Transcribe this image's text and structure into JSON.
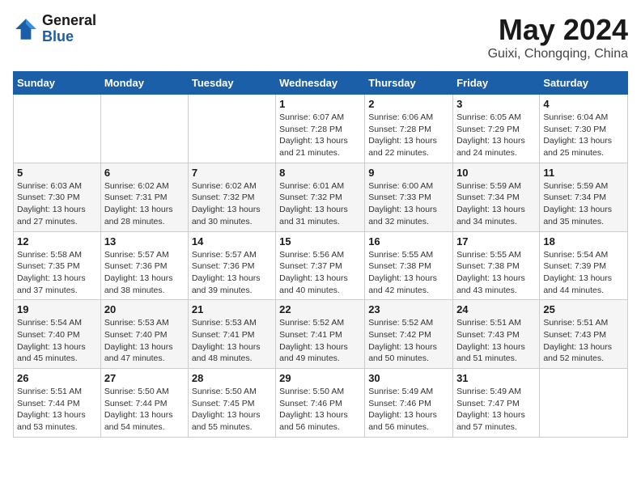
{
  "header": {
    "logo_line1": "General",
    "logo_line2": "Blue",
    "month_title": "May 2024",
    "location": "Guixi, Chongqing, China"
  },
  "days_of_week": [
    "Sunday",
    "Monday",
    "Tuesday",
    "Wednesday",
    "Thursday",
    "Friday",
    "Saturday"
  ],
  "weeks": [
    [
      {
        "day": "",
        "info": ""
      },
      {
        "day": "",
        "info": ""
      },
      {
        "day": "",
        "info": ""
      },
      {
        "day": "1",
        "info": "Sunrise: 6:07 AM\nSunset: 7:28 PM\nDaylight: 13 hours\nand 21 minutes."
      },
      {
        "day": "2",
        "info": "Sunrise: 6:06 AM\nSunset: 7:28 PM\nDaylight: 13 hours\nand 22 minutes."
      },
      {
        "day": "3",
        "info": "Sunrise: 6:05 AM\nSunset: 7:29 PM\nDaylight: 13 hours\nand 24 minutes."
      },
      {
        "day": "4",
        "info": "Sunrise: 6:04 AM\nSunset: 7:30 PM\nDaylight: 13 hours\nand 25 minutes."
      }
    ],
    [
      {
        "day": "5",
        "info": "Sunrise: 6:03 AM\nSunset: 7:30 PM\nDaylight: 13 hours\nand 27 minutes."
      },
      {
        "day": "6",
        "info": "Sunrise: 6:02 AM\nSunset: 7:31 PM\nDaylight: 13 hours\nand 28 minutes."
      },
      {
        "day": "7",
        "info": "Sunrise: 6:02 AM\nSunset: 7:32 PM\nDaylight: 13 hours\nand 30 minutes."
      },
      {
        "day": "8",
        "info": "Sunrise: 6:01 AM\nSunset: 7:32 PM\nDaylight: 13 hours\nand 31 minutes."
      },
      {
        "day": "9",
        "info": "Sunrise: 6:00 AM\nSunset: 7:33 PM\nDaylight: 13 hours\nand 32 minutes."
      },
      {
        "day": "10",
        "info": "Sunrise: 5:59 AM\nSunset: 7:34 PM\nDaylight: 13 hours\nand 34 minutes."
      },
      {
        "day": "11",
        "info": "Sunrise: 5:59 AM\nSunset: 7:34 PM\nDaylight: 13 hours\nand 35 minutes."
      }
    ],
    [
      {
        "day": "12",
        "info": "Sunrise: 5:58 AM\nSunset: 7:35 PM\nDaylight: 13 hours\nand 37 minutes."
      },
      {
        "day": "13",
        "info": "Sunrise: 5:57 AM\nSunset: 7:36 PM\nDaylight: 13 hours\nand 38 minutes."
      },
      {
        "day": "14",
        "info": "Sunrise: 5:57 AM\nSunset: 7:36 PM\nDaylight: 13 hours\nand 39 minutes."
      },
      {
        "day": "15",
        "info": "Sunrise: 5:56 AM\nSunset: 7:37 PM\nDaylight: 13 hours\nand 40 minutes."
      },
      {
        "day": "16",
        "info": "Sunrise: 5:55 AM\nSunset: 7:38 PM\nDaylight: 13 hours\nand 42 minutes."
      },
      {
        "day": "17",
        "info": "Sunrise: 5:55 AM\nSunset: 7:38 PM\nDaylight: 13 hours\nand 43 minutes."
      },
      {
        "day": "18",
        "info": "Sunrise: 5:54 AM\nSunset: 7:39 PM\nDaylight: 13 hours\nand 44 minutes."
      }
    ],
    [
      {
        "day": "19",
        "info": "Sunrise: 5:54 AM\nSunset: 7:40 PM\nDaylight: 13 hours\nand 45 minutes."
      },
      {
        "day": "20",
        "info": "Sunrise: 5:53 AM\nSunset: 7:40 PM\nDaylight: 13 hours\nand 47 minutes."
      },
      {
        "day": "21",
        "info": "Sunrise: 5:53 AM\nSunset: 7:41 PM\nDaylight: 13 hours\nand 48 minutes."
      },
      {
        "day": "22",
        "info": "Sunrise: 5:52 AM\nSunset: 7:41 PM\nDaylight: 13 hours\nand 49 minutes."
      },
      {
        "day": "23",
        "info": "Sunrise: 5:52 AM\nSunset: 7:42 PM\nDaylight: 13 hours\nand 50 minutes."
      },
      {
        "day": "24",
        "info": "Sunrise: 5:51 AM\nSunset: 7:43 PM\nDaylight: 13 hours\nand 51 minutes."
      },
      {
        "day": "25",
        "info": "Sunrise: 5:51 AM\nSunset: 7:43 PM\nDaylight: 13 hours\nand 52 minutes."
      }
    ],
    [
      {
        "day": "26",
        "info": "Sunrise: 5:51 AM\nSunset: 7:44 PM\nDaylight: 13 hours\nand 53 minutes."
      },
      {
        "day": "27",
        "info": "Sunrise: 5:50 AM\nSunset: 7:44 PM\nDaylight: 13 hours\nand 54 minutes."
      },
      {
        "day": "28",
        "info": "Sunrise: 5:50 AM\nSunset: 7:45 PM\nDaylight: 13 hours\nand 55 minutes."
      },
      {
        "day": "29",
        "info": "Sunrise: 5:50 AM\nSunset: 7:46 PM\nDaylight: 13 hours\nand 56 minutes."
      },
      {
        "day": "30",
        "info": "Sunrise: 5:49 AM\nSunset: 7:46 PM\nDaylight: 13 hours\nand 56 minutes."
      },
      {
        "day": "31",
        "info": "Sunrise: 5:49 AM\nSunset: 7:47 PM\nDaylight: 13 hours\nand 57 minutes."
      },
      {
        "day": "",
        "info": ""
      }
    ]
  ]
}
